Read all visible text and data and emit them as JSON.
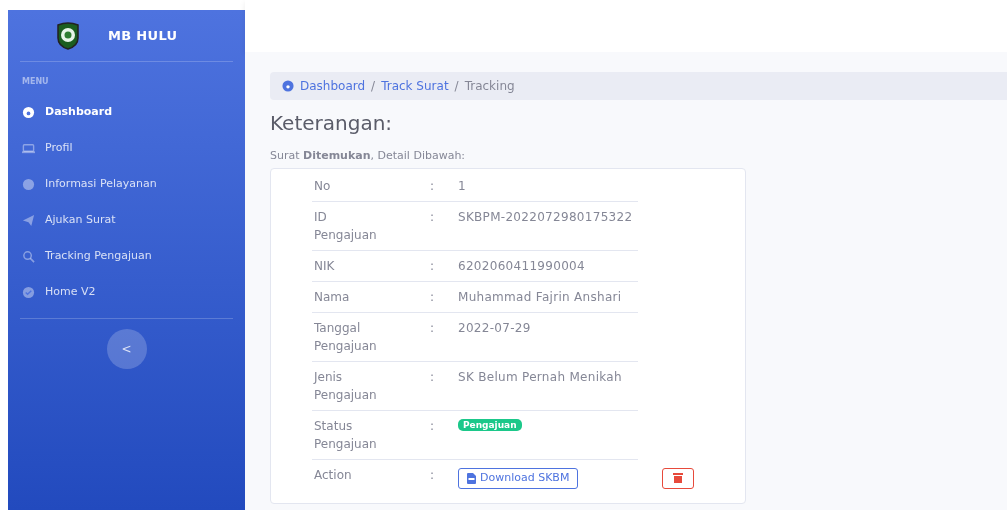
{
  "sidebar": {
    "brand": "MB HULU",
    "heading": "MENU",
    "items": [
      {
        "label": "Dashboard",
        "selected": true
      },
      {
        "label": "Profil",
        "selected": false
      },
      {
        "label": "Informasi Pelayanan",
        "selected": false
      },
      {
        "label": "Ajukan Surat",
        "selected": false
      },
      {
        "label": "Tracking Pengajuan",
        "selected": false
      },
      {
        "label": "Home V2",
        "selected": false
      }
    ],
    "toggle": "<"
  },
  "breadcrumb": [
    {
      "label": "Dashboard",
      "link": true
    },
    {
      "separator": "/",
      "label": "Track Surat",
      "link": true
    },
    {
      "separator": "/",
      "label": "Tracking",
      "link": false
    }
  ],
  "title": "Keterangan:",
  "message": "Surat **Ditemukan**, Detail Dibawah:",
  "rows": [
    {
      "kind": "text",
      "label": "No",
      "sep": ":",
      "value": "1"
    },
    {
      "kind": "text",
      "label": "ID Pengajuan",
      "sep": ":",
      "value": "SKBPM-2022072980175322"
    },
    {
      "kind": "text",
      "label": "NIK",
      "sep": ":",
      "value": "6202060411990004"
    },
    {
      "kind": "text",
      "label": "Nama",
      "sep": ":",
      "value": "Muhammad Fajrin Anshari"
    },
    {
      "kind": "text",
      "label": "Tanggal Pengajuan",
      "sep": ":",
      "value": "2022-07-29"
    },
    {
      "kind": "text",
      "label": "Jenis Pengajuan",
      "sep": ":",
      "value": "SK Belum Pernah Menikah"
    },
    {
      "kind": "badge",
      "label": "Status Pengajuan",
      "sep": ":",
      "value": "Pengajuan",
      "color": "#1cc88a"
    },
    {
      "kind": "actions",
      "label": "Action",
      "sep": ":",
      "value": "Download SKBM"
    }
  ]
}
